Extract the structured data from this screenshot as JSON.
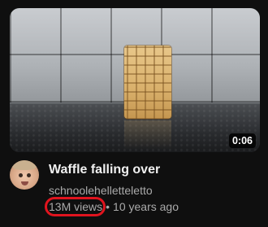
{
  "video": {
    "title": "Waffle falling over",
    "duration": "0:06",
    "channel": "schnoolehelletteletto",
    "views": "13M views",
    "separator": "•",
    "age": "10 years ago"
  },
  "colors": {
    "background": "#0f0f0f",
    "primary_text": "#f1f1f1",
    "secondary_text": "#aaaaaa",
    "highlight_ring": "#e0141e"
  }
}
